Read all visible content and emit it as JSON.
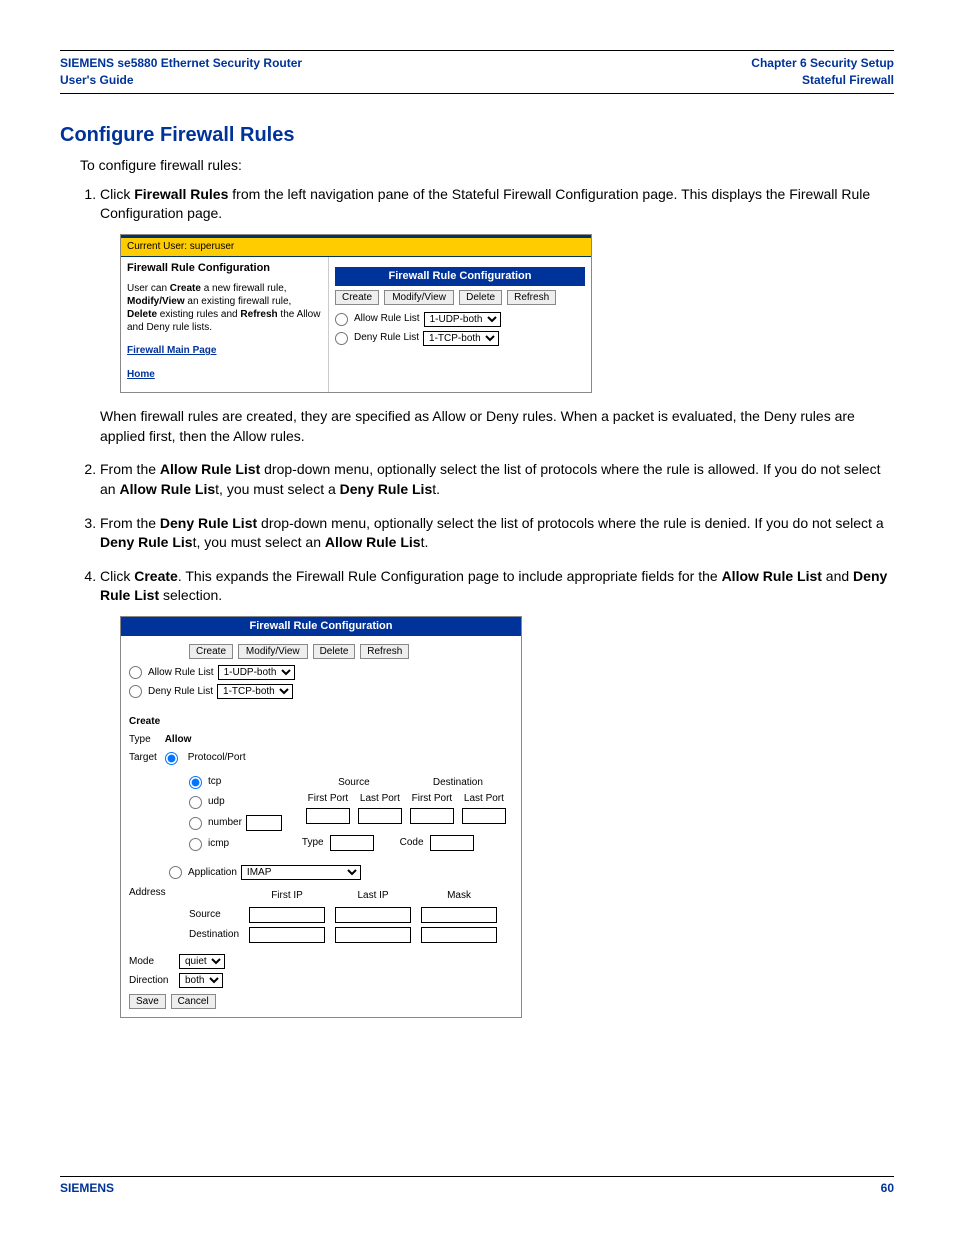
{
  "header": {
    "left_line1": "SIEMENS se5880 Ethernet Security Router",
    "left_line2": "User's Guide",
    "right_line1": "Chapter 6  Security Setup",
    "right_line2": "Stateful Firewall"
  },
  "section_title": "Configure Firewall Rules",
  "intro": "To configure firewall rules:",
  "steps": {
    "s1a": "Click ",
    "s1b": "Firewall Rules",
    "s1c": " from the left navigation pane of the Stateful Firewall Configuration page. This displays the Firewall Rule Configuration page.",
    "s1p": "When firewall rules are created, they are specified as Allow or Deny rules. When a packet is evaluated, the Deny rules are applied first, then the Allow rules.",
    "s2a": "From the ",
    "s2b": "Allow Rule List",
    "s2c": " drop-down menu, optionally select the list of protocols where the rule is allowed. If you do not select an ",
    "s2d": "Allow Rule Lis",
    "s2e": "t, you must select a ",
    "s2f": "Deny Rule Lis",
    "s2g": "t.",
    "s3a": "From the ",
    "s3b": "Deny Rule List",
    "s3c": " drop-down menu, optionally select the list of protocols where the rule is denied. If you do not select a ",
    "s3d": "Deny Rule Lis",
    "s3e": "t, you must select an ",
    "s3f": "Allow Rule Lis",
    "s3g": "t.",
    "s4a": "Click ",
    "s4b": "Create",
    "s4c": ". This expands the Firewall Rule Configuration page to include appropriate fields for the ",
    "s4d": "Allow Rule List",
    "s4e": " and ",
    "s4f": "Deny Rule List",
    "s4g": " selection."
  },
  "sc1": {
    "current_user": "Current User: superuser",
    "panel_title": "Firewall Rule Configuration",
    "panel_text_1": "User can ",
    "panel_text_create": "Create",
    "panel_text_2": " a new firewall rule, ",
    "panel_text_modify": "Modify/View",
    "panel_text_3": " an existing firewall rule, ",
    "panel_text_delete": "Delete",
    "panel_text_4": " existing rules and ",
    "panel_text_refresh": "Refresh",
    "panel_text_5": " the Allow and Deny rule lists.",
    "link_main": "Firewall Main Page",
    "link_home": "Home",
    "bar_title": "Firewall Rule Configuration",
    "btn_create": "Create",
    "btn_modify": "Modify/View",
    "btn_delete": "Delete",
    "btn_refresh": "Refresh",
    "allow_label": "Allow Rule List",
    "allow_value": "1-UDP-both",
    "deny_label": "Deny Rule List",
    "deny_value": "1-TCP-both"
  },
  "sc2": {
    "bar_title": "Firewall Rule Configuration",
    "btn_create": "Create",
    "btn_modify": "Modify/View",
    "btn_delete": "Delete",
    "btn_refresh": "Refresh",
    "allow_label": "Allow Rule List",
    "allow_value": "1-UDP-both",
    "deny_label": "Deny Rule List",
    "deny_value": "1-TCP-both",
    "create_lbl": "Create",
    "type_lbl": "Type",
    "type_val": "Allow",
    "target_lbl": "Target",
    "protoport_lbl": "Protocol/Port",
    "tcp_lbl": "tcp",
    "udp_lbl": "udp",
    "number_lbl": "number",
    "icmp_lbl": "icmp",
    "source_hdr": "Source",
    "dest_hdr": "Destination",
    "firstport_hdr": "First Port",
    "lastport_hdr": "Last Port",
    "type_hdr": "Type",
    "code_hdr": "Code",
    "application_lbl": "Application",
    "application_val": "IMAP",
    "address_lbl": "Address",
    "firstip_hdr": "First IP",
    "lastip_hdr": "Last IP",
    "mask_hdr": "Mask",
    "src_lbl": "Source",
    "dst_lbl": "Destination",
    "mode_lbl": "Mode",
    "mode_val": "quiet",
    "direction_lbl": "Direction",
    "direction_val": "both",
    "save_btn": "Save",
    "cancel_btn": "Cancel"
  },
  "footer": {
    "brand": "SIEMENS",
    "page": "60"
  }
}
